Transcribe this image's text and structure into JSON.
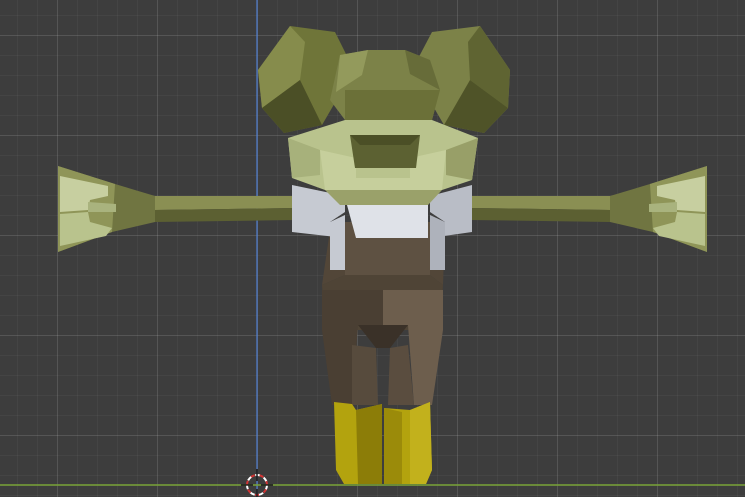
{
  "viewport": {
    "view": "3d-front-orthographic",
    "content": "low-poly-character-t-pose",
    "background_color": "#3d3d3d",
    "grid_color": "#4a4a4a",
    "z_axis_color": "#4f7fd1",
    "x_axis_color": "#7aa338"
  },
  "model": {
    "colors": {
      "skin_light": "#b9c38d",
      "skin_mid": "#7c8248",
      "skin_dark": "#4b4f26",
      "shirt": "#c6cad2",
      "overalls_light": "#6d5e4d",
      "overalls_dark": "#4a3f33",
      "boots": "#b3a30e",
      "boots_dark": "#8c7d08"
    }
  },
  "cursor": {
    "icon": "3d-cursor-icon",
    "colors": [
      "#d13434",
      "#ffffff"
    ]
  }
}
